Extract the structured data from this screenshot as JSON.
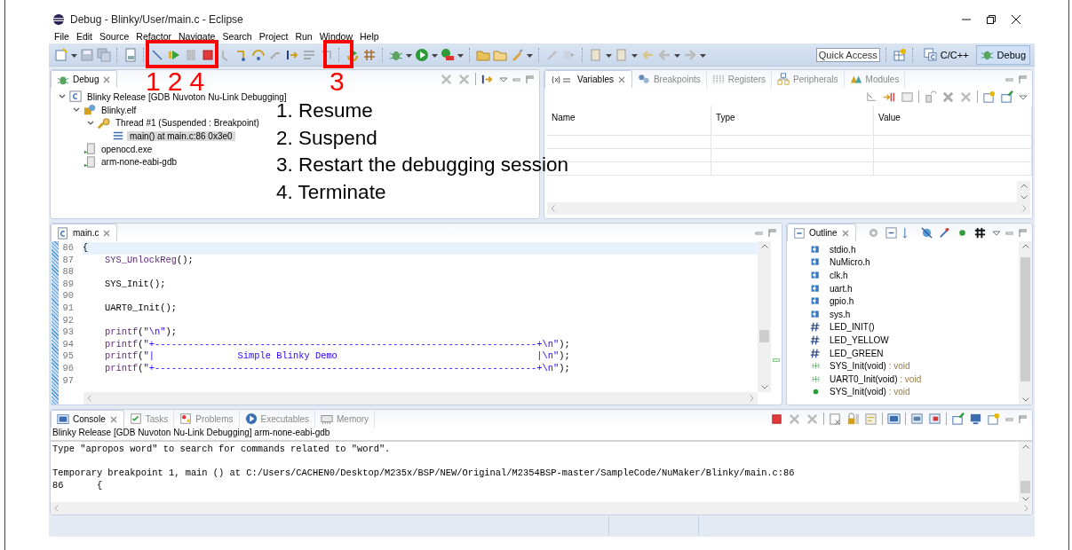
{
  "window": {
    "title": "Debug - Blinky/User/main.c - Eclipse"
  },
  "menu": [
    "File",
    "Edit",
    "Source",
    "Refactor",
    "Navigate",
    "Search",
    "Project",
    "Run",
    "Window",
    "Help"
  ],
  "toolbar": {
    "quick_access": {
      "placeholder": "Quick Access"
    },
    "perspectives": [
      {
        "label": "C/C++",
        "selected": false
      },
      {
        "label": "Debug",
        "selected": true
      }
    ]
  },
  "debug_view": {
    "tab": "Debug",
    "tree": [
      {
        "label": "Blinky Release [GDB Nuvoton Nu-Link Debugging]",
        "kind": "launch",
        "selected": false,
        "expanded": true,
        "children": [
          {
            "label": "Blinky.elf",
            "kind": "program",
            "selected": false,
            "expanded": true,
            "children": [
              {
                "label": "Thread #1 (Suspended : Breakpoint)",
                "kind": "thread",
                "selected": false,
                "expanded": true,
                "children": [
                  {
                    "label": "main() at main.c:86 0x3e0",
                    "kind": "frame",
                    "selected": true
                  }
                ]
              }
            ]
          },
          {
            "label": "openocd.exe",
            "kind": "process",
            "selected": false
          },
          {
            "label": "arm-none-eabi-gdb",
            "kind": "process",
            "selected": false
          }
        ]
      }
    ]
  },
  "variables_view": {
    "tabs": [
      {
        "label": "Variables",
        "kind": "variables",
        "selected": true
      },
      {
        "label": "Breakpoints",
        "kind": "breakpoints",
        "selected": false
      },
      {
        "label": "Registers",
        "kind": "registers",
        "selected": false
      },
      {
        "label": "Peripherals",
        "kind": "peripherals",
        "selected": false
      },
      {
        "label": "Modules",
        "kind": "modules",
        "selected": false
      }
    ],
    "columns": [
      "Name",
      "Type",
      "Value"
    ]
  },
  "editor": {
    "tab": "main.c",
    "lines": [
      {
        "number": "86",
        "current": true,
        "tokens": [
          {
            "text": "{",
            "kind": "plain"
          }
        ]
      },
      {
        "number": "87",
        "current": false,
        "tokens": [
          {
            "text": "    SYS_UnlockReg",
            "kind": "macro"
          },
          {
            "text": "();",
            "kind": "plain"
          }
        ]
      },
      {
        "number": "88",
        "current": false
      },
      {
        "number": "89",
        "current": false,
        "tokens": [
          {
            "text": "    SYS_Init();",
            "kind": "plain"
          }
        ]
      },
      {
        "number": "90",
        "current": false
      },
      {
        "number": "91",
        "current": false,
        "tokens": [
          {
            "text": "    UART0_Init();",
            "kind": "plain"
          }
        ]
      },
      {
        "number": "92",
        "current": false
      },
      {
        "number": "93",
        "current": false,
        "tokens": [
          {
            "text": "    printf",
            "kind": "macro"
          },
          {
            "text": "(",
            "kind": "plain"
          },
          {
            "text": "\"\\n\"",
            "kind": "string"
          },
          {
            "text": ");",
            "kind": "plain"
          }
        ]
      },
      {
        "number": "94",
        "current": false,
        "tokens": [
          {
            "text": "    printf",
            "kind": "macro"
          },
          {
            "text": "(",
            "kind": "plain"
          },
          {
            "text": "\"+---------------------------------------------------------------------+\\n\"",
            "kind": "string"
          },
          {
            "text": ");",
            "kind": "plain"
          }
        ]
      },
      {
        "number": "95",
        "current": false,
        "tokens": [
          {
            "text": "    printf",
            "kind": "macro"
          },
          {
            "text": "(",
            "kind": "plain"
          },
          {
            "text": "\"|               Simple Blinky Demo                                    |\\n\"",
            "kind": "string"
          },
          {
            "text": ");",
            "kind": "plain"
          }
        ]
      },
      {
        "number": "96",
        "current": false,
        "tokens": [
          {
            "text": "    printf",
            "kind": "macro"
          },
          {
            "text": "(",
            "kind": "plain"
          },
          {
            "text": "\"+---------------------------------------------------------------------+\\n\"",
            "kind": "string"
          },
          {
            "text": ");",
            "kind": "plain"
          }
        ]
      },
      {
        "number": "97",
        "current": false
      }
    ]
  },
  "outline": {
    "tab": "Outline",
    "items": [
      {
        "label": "stdio.h",
        "kind": "include"
      },
      {
        "label": "NuMicro.h",
        "kind": "include"
      },
      {
        "label": "clk.h",
        "kind": "include"
      },
      {
        "label": "uart.h",
        "kind": "include"
      },
      {
        "label": "gpio.h",
        "kind": "include"
      },
      {
        "label": "sys.h",
        "kind": "include"
      },
      {
        "label": "LED_INIT()",
        "kind": "macro"
      },
      {
        "label": "LED_YELLOW",
        "kind": "macro"
      },
      {
        "label": "LED_GREEN",
        "kind": "macro"
      },
      {
        "label": "SYS_Init(void)",
        "type": ": void",
        "kind": "declaration"
      },
      {
        "label": "UART0_Init(void)",
        "type": ": void",
        "kind": "declaration"
      },
      {
        "label": "SYS_Init(void)",
        "type": ": void",
        "kind": "function"
      }
    ]
  },
  "console": {
    "tabs": [
      {
        "label": "Console",
        "kind": "console",
        "selected": true
      },
      {
        "label": "Tasks",
        "kind": "tasks",
        "selected": false
      },
      {
        "label": "Problems",
        "kind": "problems",
        "selected": false
      },
      {
        "label": "Executables",
        "kind": "executables",
        "selected": false
      },
      {
        "label": "Memory",
        "kind": "memory",
        "selected": false
      }
    ],
    "header": "Blinky Release [GDB Nuvoton Nu-Link Debugging] arm-none-eabi-gdb",
    "blocks": [
      [
        "Type \"apropos word\" to search for commands related to \"word\"."
      ],
      [
        "Temporary breakpoint 1, main () at C:/Users/CACHEN0/Desktop/M235x/BSP/NEW/Original/M2354BSP-master/SampleCode/NuMaker/Blinky/main.c:86",
        "86      {"
      ]
    ]
  },
  "annotations": {
    "callouts": [
      {
        "labels": [
          "1",
          "2",
          "4"
        ]
      },
      {
        "labels": [
          "3"
        ]
      }
    ],
    "steps": [
      "1. Resume",
      "2. Suspend",
      "3. Restart the debugging session",
      "4. Terminate"
    ]
  }
}
